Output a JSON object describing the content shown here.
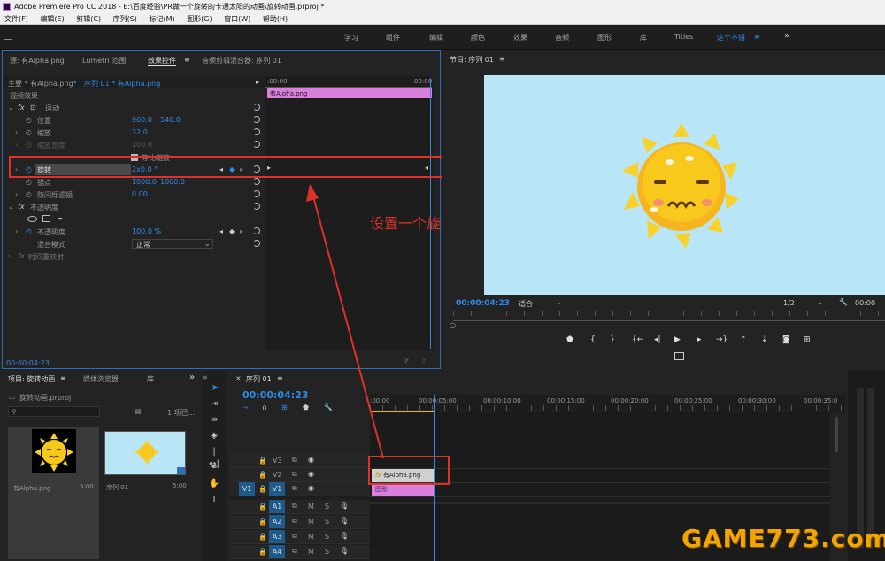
{
  "title": "Adobe Premiere Pro CC 2018 - E:\\百度经验\\PR做一个旋转的卡通太阳的动画\\旋转动画.prproj *",
  "menu": [
    "文件(F)",
    "编辑(E)",
    "剪辑(C)",
    "序列(S)",
    "标记(M)",
    "图形(G)",
    "窗口(W)",
    "帮助(H)"
  ],
  "workspaces": [
    "学习",
    "组件",
    "编辑",
    "颜色",
    "效果",
    "音频",
    "图形",
    "库",
    "Titles",
    "这个不错",
    "≡",
    "»"
  ],
  "effect_controls": {
    "tabs": [
      "源: 有Alpha.png",
      "Lumetri 范围",
      "效果控件",
      "音频剪辑混合器: 序列 01"
    ],
    "master": "主要 * 有Alpha.png",
    "sequence": "序列 01 * 有Alpha.png",
    "ruler_start": ":00:00",
    "ruler_end": "00:00",
    "clip_name": "有Alpha.png",
    "video_effects": "视频效果",
    "motion": "运动",
    "position_label": "位置",
    "position_x": "960.0",
    "position_y": "540.0",
    "scale_label": "缩放",
    "scale_value": "32.0",
    "scale_width_label": "缩放宽度",
    "scale_width_value": "100.0",
    "uniform_label": "等比缩放",
    "rotation_label": "旋转",
    "rotation_value": "2x0.0 °",
    "anchor_label": "锚点",
    "anchor_x": "1000.0",
    "anchor_y": "1000.0",
    "antiflicker_label": "防闪烁滤镜",
    "antiflicker_value": "0.00",
    "opacity_section": "不透明度",
    "opacity_label": "不透明度",
    "opacity_value": "100.0 %",
    "blend_label": "混合模式",
    "blend_value": "正常",
    "time_remap": "时间重映射",
    "timecode": "00:00:04:23"
  },
  "annotation": "设置一个旋转的关键帧动画",
  "program": {
    "title": "节目: 序列 01",
    "timecode": "00:00:04:23",
    "fit": "适合",
    "resolution": "1/2",
    "right_timecode": "00:00"
  },
  "project": {
    "tabs": [
      "项目: 旋转动画",
      "媒体浏览器",
      "库"
    ],
    "file": "旋转动画.prproj",
    "count": "1 项已...",
    "items": [
      {
        "name": "有Alpha.png",
        "duration": "5:00"
      },
      {
        "name": "序列 01",
        "duration": "5:00"
      }
    ]
  },
  "timeline": {
    "tab": "序列 01",
    "timecode": "00:00:04:23",
    "ruler": [
      ":00:00",
      "00:00:05:00",
      "00:00:10:00",
      "00:00:15:00",
      "00:00:20:00",
      "00:00:25:00",
      "00:00:30:00",
      "00:00:35:0"
    ],
    "video_tracks": [
      "V3",
      "V2",
      "V1"
    ],
    "audio_tracks": [
      "A1",
      "A2",
      "A3",
      "A4"
    ],
    "source_label": "V1",
    "clip_v2": "有Alpha.png",
    "clip_v1": "图形",
    "mute": "M",
    "solo": "S"
  },
  "watermark": "GAME773.com",
  "colors": {
    "accent": "#2d8ceb",
    "clip": "#d97fdc",
    "sky": "#b9e6f7",
    "annotation": "#e0302a",
    "sun": "#f8c81c"
  }
}
